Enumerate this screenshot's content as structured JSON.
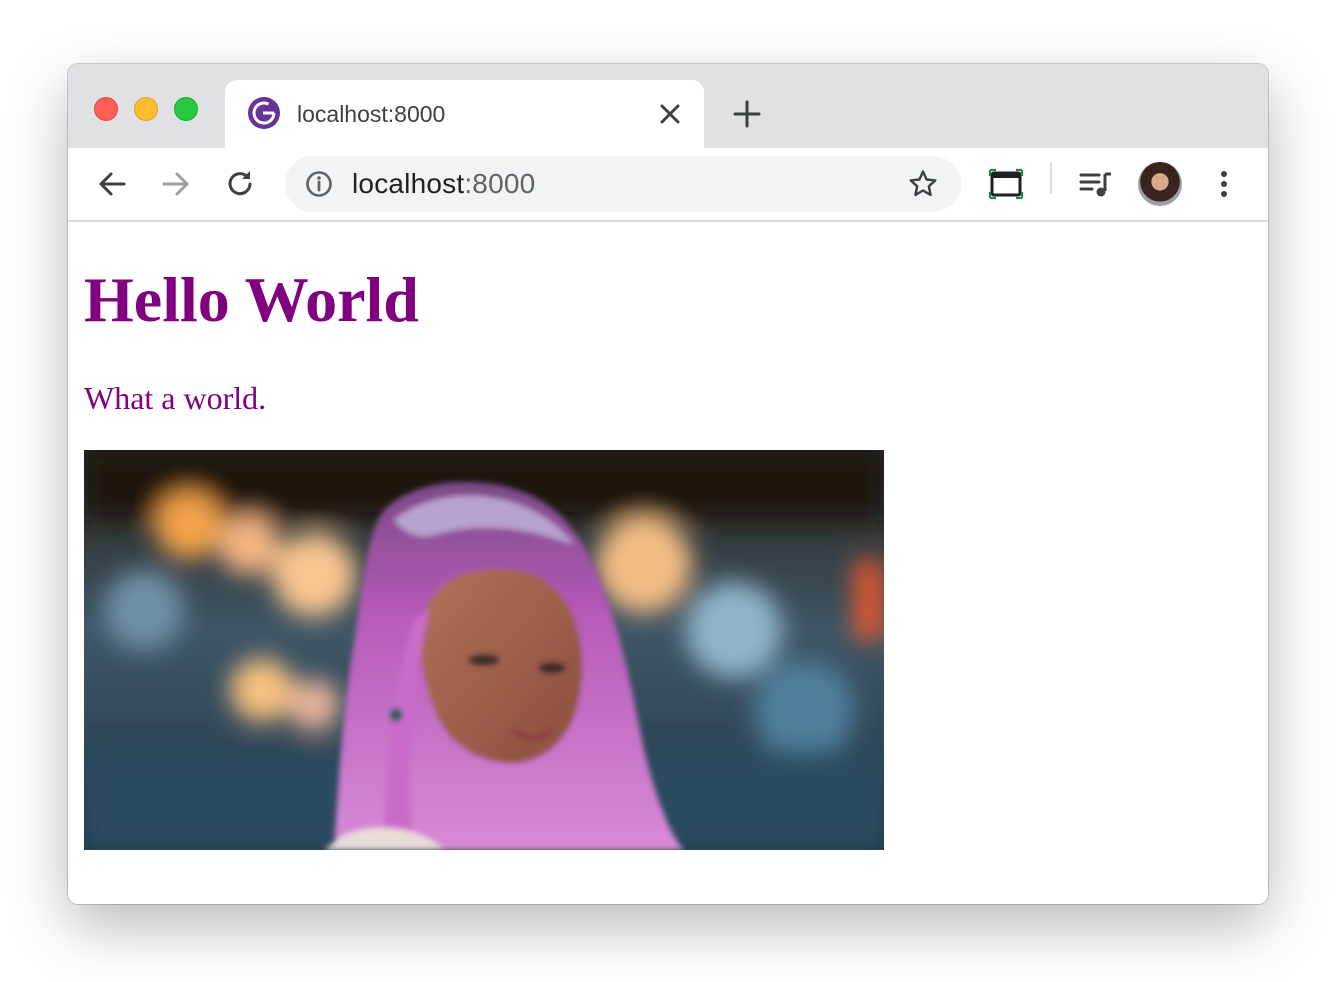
{
  "browser": {
    "tab": {
      "title": "localhost:8000",
      "favicon": "gatsby-logo-icon"
    },
    "address_bar": {
      "host": "localhost",
      "port": ":8000"
    },
    "icons": {
      "back": "arrow-left-icon",
      "forward": "arrow-right-icon",
      "reload": "reload-icon",
      "info": "info-icon",
      "bookmark": "star-icon",
      "cast": "cast-icon",
      "media": "media-queue-icon",
      "profile": "avatar",
      "menu": "more-vert-icon"
    }
  },
  "page": {
    "heading": "Hello World",
    "paragraph": "What a world.",
    "image": "photo of a woman with pink hair against a blurred city background"
  },
  "colors": {
    "text": "#800080",
    "chrome_frame": "#dfe1e5",
    "omnibox": "#f1f3f4",
    "favicon": "#663399"
  }
}
